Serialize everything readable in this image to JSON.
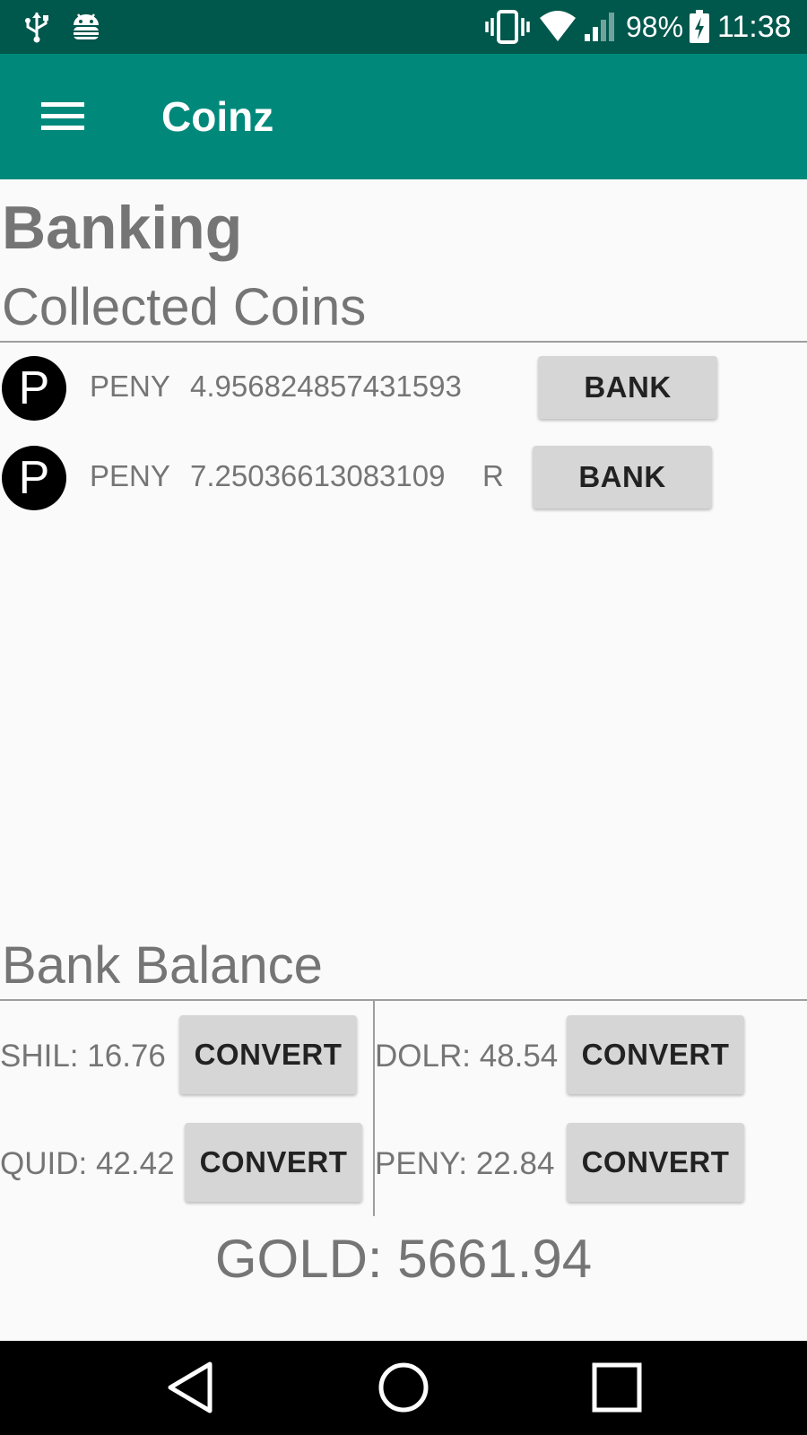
{
  "status_bar": {
    "battery": "98%",
    "time": "11:38",
    "icons": [
      "usb-icon",
      "android-debug-icon",
      "vibrate-icon",
      "wifi-icon",
      "signal-icon",
      "battery-charging-icon"
    ]
  },
  "app_bar": {
    "title": "Coinz",
    "menu_icon": "hamburger-menu-icon"
  },
  "page": {
    "title": "Banking",
    "collected_title": "Collected Coins",
    "bank_balance_title": "Bank Balance"
  },
  "coins": [
    {
      "icon_letter": "P",
      "currency": "PENY",
      "value": "4.956824857431593",
      "flag": "",
      "button": "BANK"
    },
    {
      "icon_letter": "P",
      "currency": "PENY",
      "value": "7.25036613083109",
      "flag": "R",
      "button": "BANK"
    }
  ],
  "balances": [
    {
      "label": "SHIL: 16.76",
      "button": "CONVERT"
    },
    {
      "label": "DOLR: 48.54",
      "button": "CONVERT"
    },
    {
      "label": "QUID: 42.42",
      "button": "CONVERT"
    },
    {
      "label": "PENY: 22.84",
      "button": "CONVERT"
    }
  ],
  "gold": "GOLD: 5661.94",
  "nav_bar": {
    "icons": [
      "back-icon",
      "home-icon",
      "recents-icon"
    ]
  },
  "colors": {
    "status_bar": "#00574c",
    "app_bar": "#00897b",
    "text_gray": "#757575",
    "button": "#d6d6d6"
  }
}
